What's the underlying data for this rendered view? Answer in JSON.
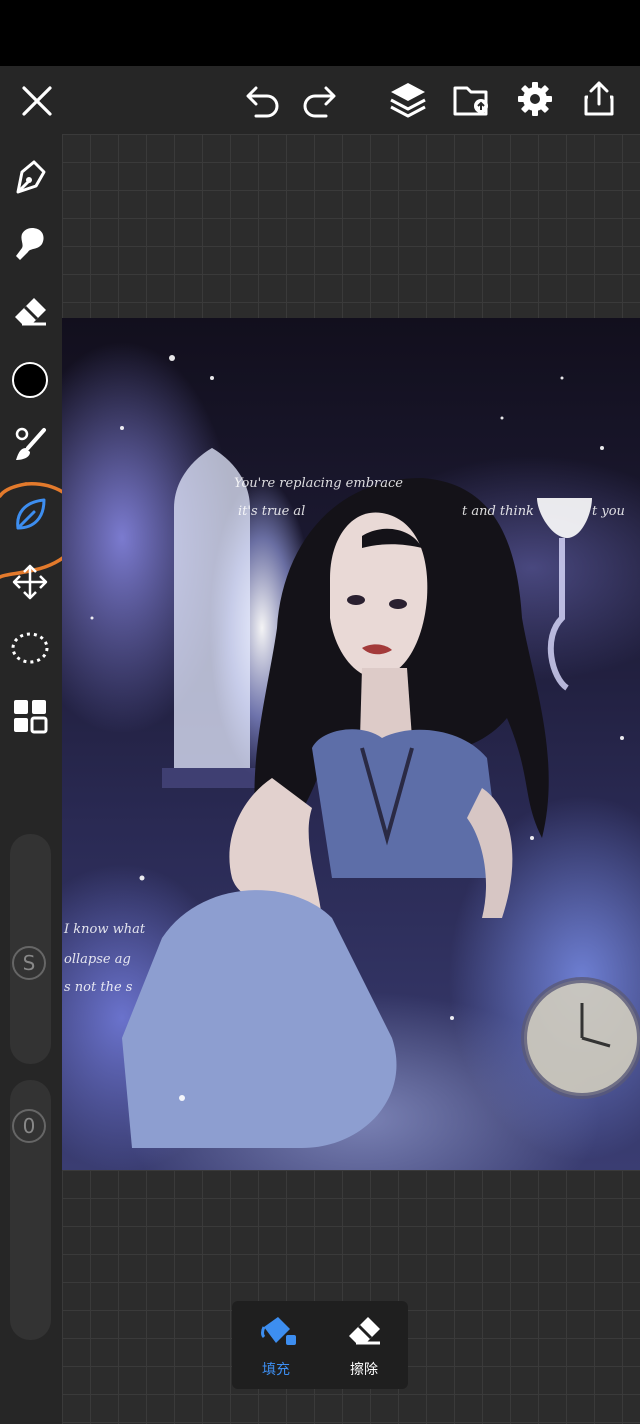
{
  "toolbar": {
    "close": "close-icon",
    "undo": "undo-icon",
    "redo": "redo-icon",
    "layers": "layers-icon",
    "gallery": "gallery-icon",
    "settings": "gear-icon",
    "export": "share-icon"
  },
  "tools": [
    {
      "name": "brush",
      "icon": "pen-icon"
    },
    {
      "name": "smudge",
      "icon": "smudge-icon"
    },
    {
      "name": "eraser",
      "icon": "eraser-icon"
    },
    {
      "name": "color",
      "icon": "color-swatch",
      "color": "#000000"
    },
    {
      "name": "adjust-brush",
      "icon": "brush-adjust-icon"
    },
    {
      "name": "leaf",
      "icon": "leaf-icon",
      "active": true
    },
    {
      "name": "transform",
      "icon": "move-icon"
    },
    {
      "name": "selection",
      "icon": "lasso-icon"
    },
    {
      "name": "more",
      "icon": "grid-icon"
    }
  ],
  "sliders": {
    "size_label": "S",
    "opacity_label": "0"
  },
  "artwork": {
    "lines": [
      "You're replacing embrace",
      "it's true al",
      "t and think",
      "t you",
      "I know what",
      "ollapse ag",
      "s not the s"
    ]
  },
  "fill_popup": {
    "fill_label": "填充",
    "erase_label": "擦除"
  },
  "colors": {
    "accent": "#3d8ef0",
    "annotation": "#e37a2c",
    "panel": "#262626"
  }
}
